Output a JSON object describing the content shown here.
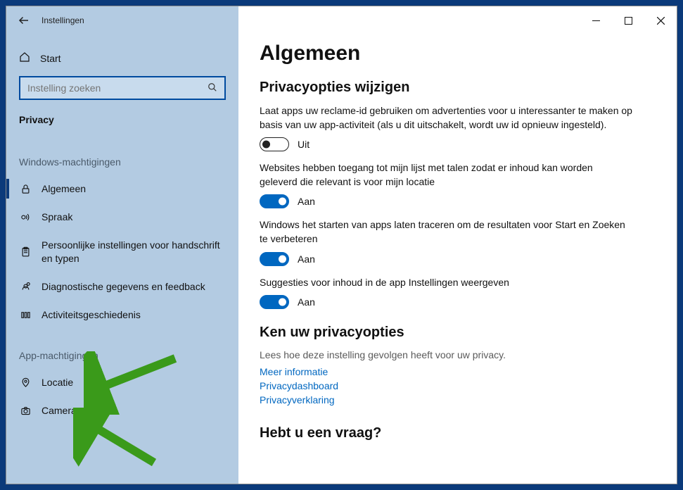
{
  "window": {
    "title": "Instellingen"
  },
  "sidebar": {
    "home": "Start",
    "search_placeholder": "Instelling zoeken",
    "category": "Privacy",
    "group1": "Windows-machtigingen",
    "items1": [
      {
        "label": "Algemeen"
      },
      {
        "label": "Spraak"
      },
      {
        "label": "Persoonlijke instellingen voor handschrift en typen"
      },
      {
        "label": "Diagnostische gegevens en feedback"
      },
      {
        "label": "Activiteitsgeschiedenis"
      }
    ],
    "group2": "App-machtigingen",
    "items2": [
      {
        "label": "Locatie"
      },
      {
        "label": "Camera"
      }
    ]
  },
  "main": {
    "heading": "Algemeen",
    "subheading": "Privacyopties wijzigen",
    "toggles": [
      {
        "desc": "Laat apps uw reclame-id gebruiken om advertenties voor u interessanter te maken op basis van uw app-activiteit (als u dit uitschakelt, wordt uw id opnieuw ingesteld).",
        "state": "off",
        "value": "Uit"
      },
      {
        "desc": "Websites hebben toegang tot mijn lijst met talen zodat er inhoud kan worden geleverd die relevant is voor mijn locatie",
        "state": "on",
        "value": "Aan"
      },
      {
        "desc": "Windows het starten van apps laten traceren om de resultaten voor Start en Zoeken te verbeteren",
        "state": "on",
        "value": "Aan"
      },
      {
        "desc": "Suggesties voor inhoud in de app Instellingen weergeven",
        "state": "on",
        "value": "Aan"
      }
    ],
    "know_title": "Ken uw privacyopties",
    "know_lead": "Lees hoe deze instelling gevolgen heeft voor uw privacy.",
    "links": [
      {
        "label": "Meer informatie"
      },
      {
        "label": "Privacydashboard"
      },
      {
        "label": "Privacyverklaring"
      }
    ],
    "question": "Hebt u een vraag?"
  }
}
